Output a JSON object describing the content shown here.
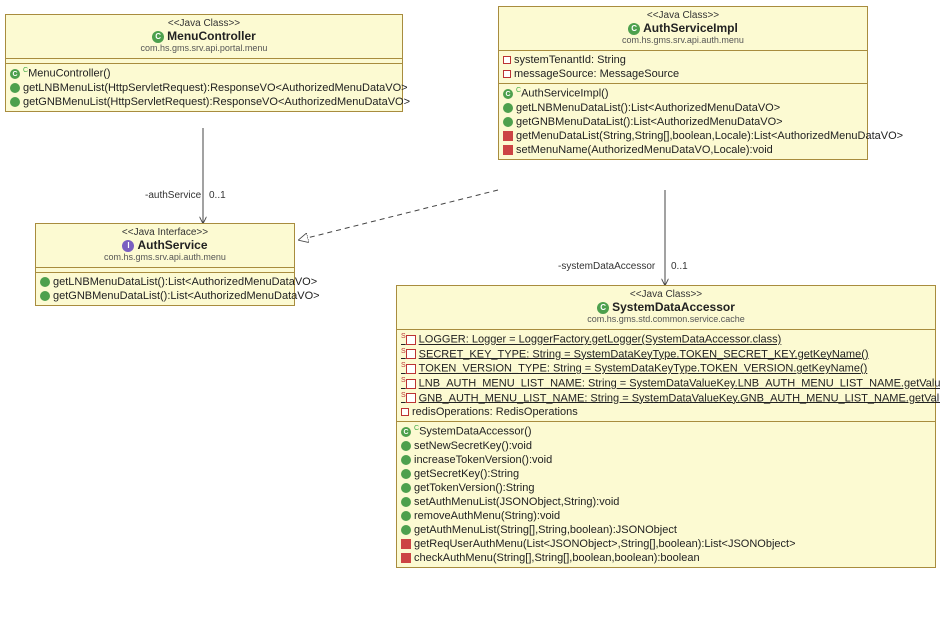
{
  "menuController": {
    "stereo": "<<Java Class>>",
    "title": "MenuController",
    "pkg": "com.hs.gms.srv.api.portal.menu",
    "ctor": "MenuController()",
    "m1": "getLNBMenuList(HttpServletRequest):ResponseVO<AuthorizedMenuDataVO>",
    "m2": "getGNBMenuList(HttpServletRequest):ResponseVO<AuthorizedMenuDataVO>"
  },
  "authServiceImpl": {
    "stereo": "<<Java Class>>",
    "title": "AuthServiceImpl",
    "pkg": "com.hs.gms.srv.api.auth.menu",
    "f1": "systemTenantId: String",
    "f2": "messageSource: MessageSource",
    "ctor": "AuthServiceImpl()",
    "m1": "getLNBMenuDataList():List<AuthorizedMenuDataVO>",
    "m2": "getGNBMenuDataList():List<AuthorizedMenuDataVO>",
    "m3": "getMenuDataList(String,String[],boolean,Locale):List<AuthorizedMenuDataVO>",
    "m4": "setMenuName(AuthorizedMenuDataVO,Locale):void"
  },
  "authService": {
    "stereo": "<<Java Interface>>",
    "title": "AuthService",
    "pkg": "com.hs.gms.srv.api.auth.menu",
    "m1": "getLNBMenuDataList():List<AuthorizedMenuDataVO>",
    "m2": "getGNBMenuDataList():List<AuthorizedMenuDataVO>"
  },
  "systemDataAccessor": {
    "stereo": "<<Java Class>>",
    "title": "SystemDataAccessor",
    "pkg": "com.hs.gms.std.common.service.cache",
    "f1": "LOGGER: Logger = LoggerFactory.getLogger(SystemDataAccessor.class)",
    "f2": "SECRET_KEY_TYPE: String = SystemDataKeyType.TOKEN_SECRET_KEY.getKeyName()",
    "f3": "TOKEN_VERSION_TYPE: String = SystemDataKeyType.TOKEN_VERSION.getKeyName()",
    "f4": "LNB_AUTH_MENU_LIST_NAME: String = SystemDataValueKey.LNB_AUTH_MENU_LIST_NAME.getValueKey()",
    "f5": "GNB_AUTH_MENU_LIST_NAME: String = SystemDataValueKey.GNB_AUTH_MENU_LIST_NAME.getValueKey()",
    "f6": "redisOperations: RedisOperations",
    "ctor": "SystemDataAccessor()",
    "m1": "setNewSecretKey():void",
    "m2": "increaseTokenVersion():void",
    "m3": "getSecretKey():String",
    "m4": "getTokenVersion():String",
    "m5": "setAuthMenuList(JSONObject,String):void",
    "m6": "removeAuthMenu(String):void",
    "m7": "getAuthMenuList(String[],String,boolean):JSONObject",
    "m8": "getReqUserAuthMenu(List<JSONObject>,String[],boolean):List<JSONObject>",
    "m9": "checkAuthMenu(String[],String[],boolean,boolean):boolean"
  },
  "edges": {
    "authSvc": "-authService",
    "authSvcMul": "0..1",
    "sysData": "-systemDataAccessor",
    "sysDataMul": "0..1"
  }
}
